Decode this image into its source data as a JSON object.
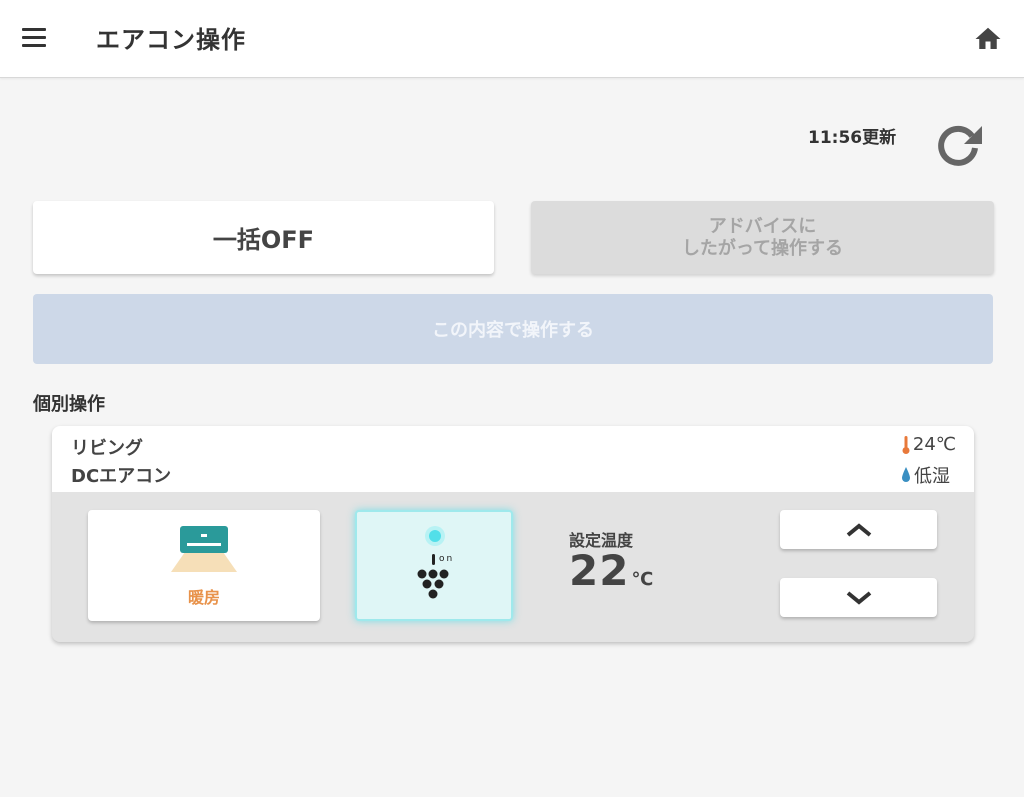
{
  "header": {
    "title": "エアコン操作",
    "menu_icon": "hamburger-menu-icon",
    "home_icon": "home-icon"
  },
  "update": {
    "text": "11:56更新",
    "refresh_icon": "refresh-icon"
  },
  "actions": {
    "all_off_label": "一括OFF",
    "advice_line1": "アドバイスに",
    "advice_line2": "したがって操作する",
    "apply_label": "この内容で操作する"
  },
  "individual": {
    "section_title": "個別操作",
    "device": {
      "room": "リビング",
      "name": "DCエアコン",
      "room_temperature": "24℃",
      "humidity": "低湿",
      "mode_label": "暖房",
      "ion_label": "on",
      "set_temp_label": "設定温度",
      "set_temp_value": "22",
      "set_temp_unit": "℃"
    }
  },
  "colors": {
    "header_bg": "#ffffff",
    "page_bg": "#f5f5f5",
    "apply_button_bg": "#cdd8e8",
    "advice_button_bg": "#dcdcdc",
    "heating_orange": "#e8924a",
    "aircon_teal": "#2a9a9a",
    "ion_glow": "#5de0ea",
    "thermometer_orange": "#e8793a",
    "drop_blue": "#3a8fc2"
  }
}
